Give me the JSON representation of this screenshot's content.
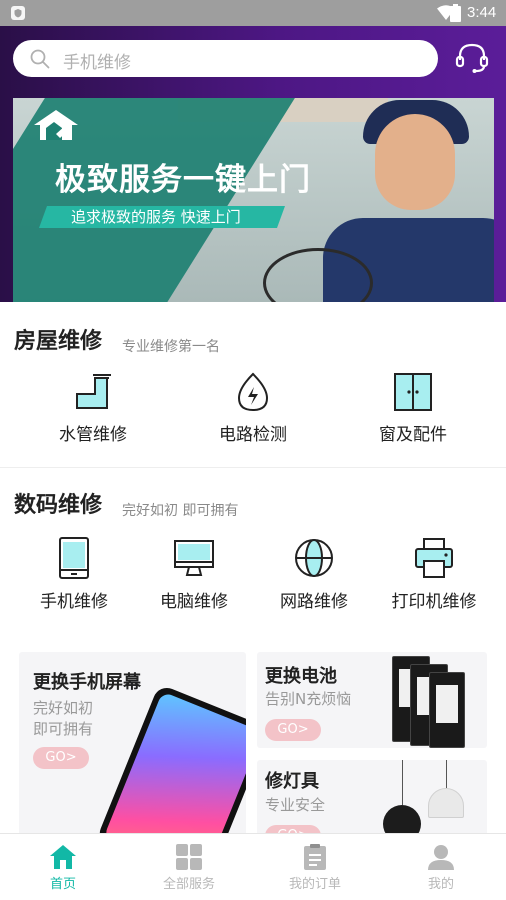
{
  "status_bar": {
    "time": "3:44"
  },
  "search": {
    "placeholder": "手机维修"
  },
  "banner": {
    "headline": "极致服务一键上门",
    "subline": "追求极致的服务 快速上门"
  },
  "house_section": {
    "title": "房屋维修",
    "subtitle": "专业维修第一名",
    "items": [
      {
        "label": "水管维修",
        "icon": "water-pipe-icon"
      },
      {
        "label": "电路检测",
        "icon": "electric-circuit-icon"
      },
      {
        "label": "窗及配件",
        "icon": "window-icon"
      }
    ]
  },
  "digital_section": {
    "title": "数码维修",
    "subtitle": "完好如初 即可拥有",
    "items": [
      {
        "label": "手机维修",
        "icon": "phone-icon"
      },
      {
        "label": "电脑维修",
        "icon": "computer-icon"
      },
      {
        "label": "网路维修",
        "icon": "globe-icon"
      },
      {
        "label": "打印机维修",
        "icon": "printer-icon"
      }
    ]
  },
  "promo_cards": {
    "screen": {
      "title": "更换手机屏幕",
      "desc_line1": "完好如初",
      "desc_line2": "即可拥有",
      "button": "GO>"
    },
    "battery": {
      "title": "更换电池",
      "desc": "告别N充烦恼",
      "button": "GO>"
    },
    "lamp": {
      "title": "修灯具",
      "desc": "专业安全",
      "button": "GO>"
    }
  },
  "tab_bar": {
    "active_color": "#12b8a6",
    "inactive_color": "#b8b8b8",
    "tabs": [
      {
        "label": "首页",
        "icon": "home-icon",
        "active": true
      },
      {
        "label": "全部服务",
        "icon": "grid-icon",
        "active": false
      },
      {
        "label": "我的订单",
        "icon": "clipboard-icon",
        "active": false
      },
      {
        "label": "我的",
        "icon": "user-icon",
        "active": false
      }
    ]
  },
  "colors": {
    "accent": "#12b8a6",
    "header_purple": "#4d1784",
    "go_pink": "#f3c3c8"
  }
}
